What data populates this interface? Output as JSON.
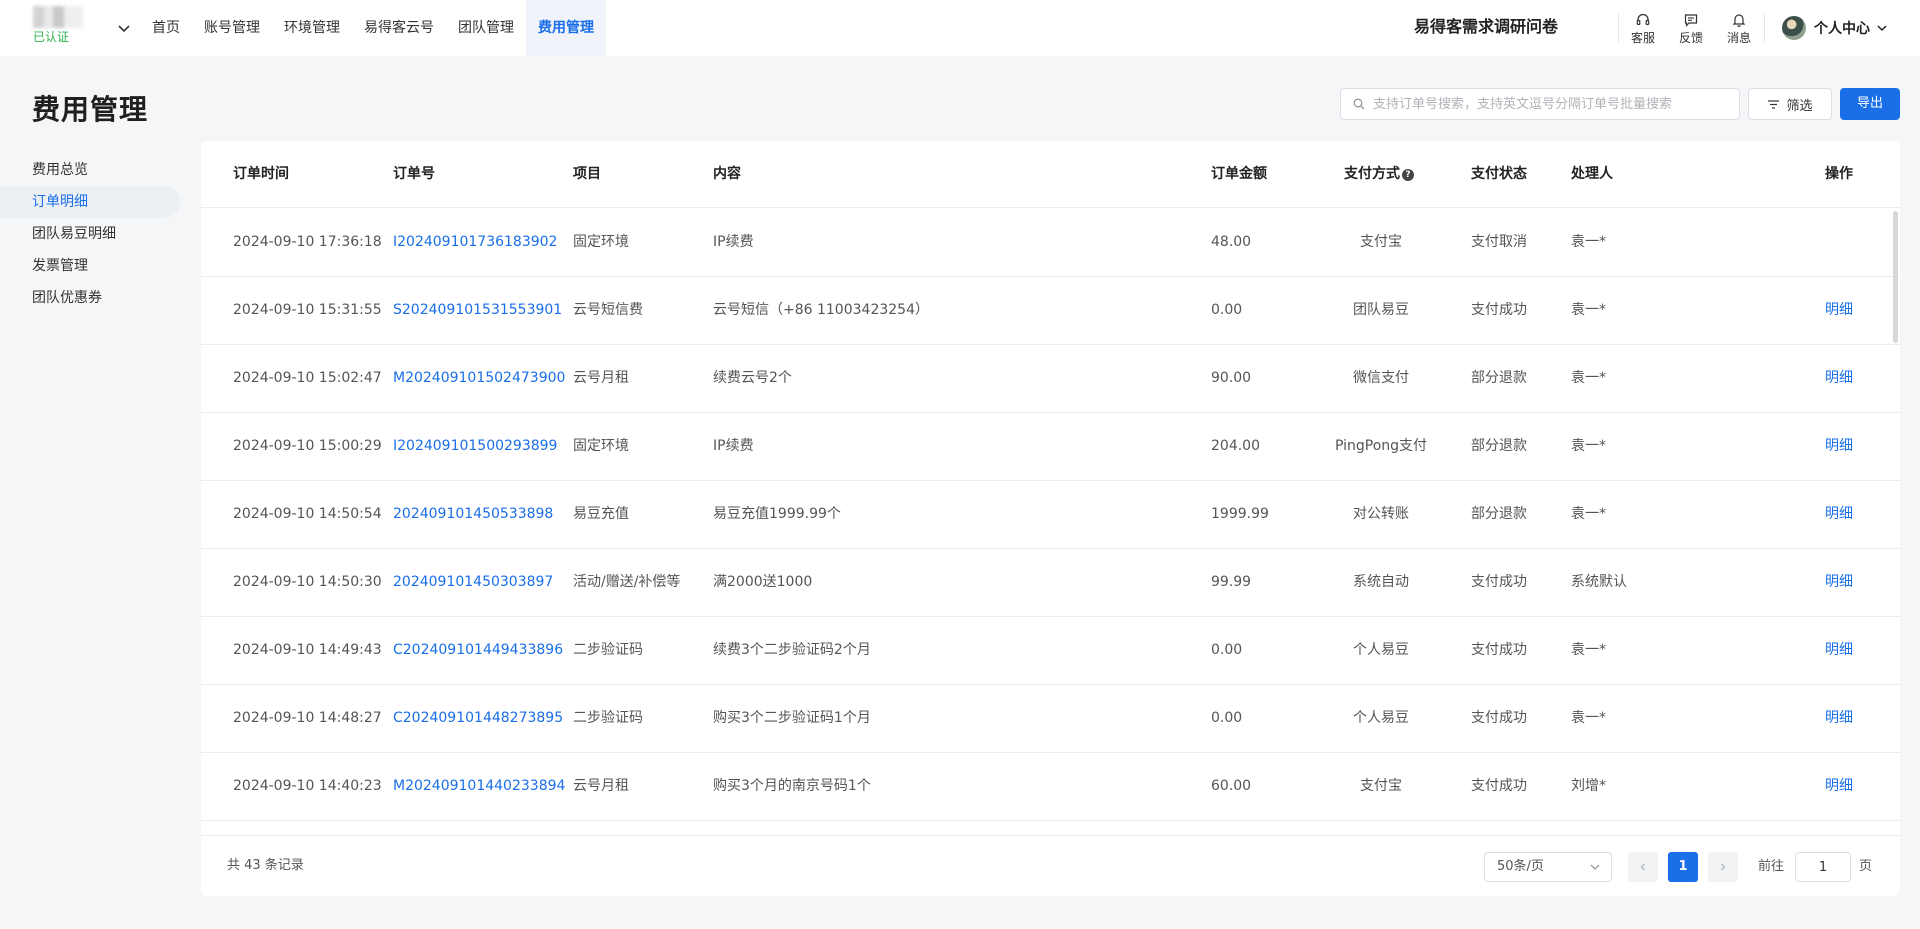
{
  "brand": {
    "verified": "已认证"
  },
  "nav": [
    {
      "label": "首页"
    },
    {
      "label": "账号管理"
    },
    {
      "label": "环境管理"
    },
    {
      "label": "易得客云号"
    },
    {
      "label": "团队管理"
    },
    {
      "label": "费用管理",
      "active": true
    }
  ],
  "header": {
    "survey": "易得客需求调研问卷",
    "tools": {
      "service": "客服",
      "feedback": "反馈",
      "messages": "消息"
    },
    "user": "个人中心"
  },
  "page": {
    "title": "费用管理",
    "search_placeholder": "支持订单号搜索，支持英文逗号分隔订单号批量搜索",
    "filter": "筛选",
    "export": "导出"
  },
  "sidebar": [
    {
      "label": "费用总览"
    },
    {
      "label": "订单明细",
      "active": true
    },
    {
      "label": "团队易豆明细"
    },
    {
      "label": "发票管理"
    },
    {
      "label": "团队优惠券"
    }
  ],
  "table": {
    "columns": {
      "time": "订单时间",
      "order_no": "订单号",
      "project": "项目",
      "content": "内容",
      "amount": "订单金额",
      "pay_method": "支付方式",
      "pay_method_help": "?",
      "pay_status": "支付状态",
      "handler": "处理人",
      "action": "操作"
    },
    "rows": [
      {
        "time": "2024-09-10 17:36:18",
        "order_no": "I202409101736183902",
        "project": "固定环境",
        "content": "IP续费",
        "amount": "48.00",
        "pay_method": "支付宝",
        "pay_status": "支付取消",
        "handler": "袁一*",
        "action": ""
      },
      {
        "time": "2024-09-10 15:31:55",
        "order_no": "S202409101531553901",
        "project": "云号短信费",
        "content": "云号短信（+86 11003423254）",
        "amount": "0.00",
        "pay_method": "团队易豆",
        "pay_status": "支付成功",
        "handler": "袁一*",
        "action": "明细"
      },
      {
        "time": "2024-09-10 15:02:47",
        "order_no": "M202409101502473900",
        "project": "云号月租",
        "content": "续费云号2个",
        "amount": "90.00",
        "pay_method": "微信支付",
        "pay_status": "部分退款",
        "handler": "袁一*",
        "action": "明细"
      },
      {
        "time": "2024-09-10 15:00:29",
        "order_no": "I202409101500293899",
        "project": "固定环境",
        "content": "IP续费",
        "amount": "204.00",
        "pay_method": "PingPong支付",
        "pay_status": "部分退款",
        "handler": "袁一*",
        "action": "明细"
      },
      {
        "time": "2024-09-10 14:50:54",
        "order_no": "202409101450533898",
        "project": "易豆充值",
        "content": "易豆充值1999.99个",
        "amount": "1999.99",
        "pay_method": "对公转账",
        "pay_status": "部分退款",
        "handler": "袁一*",
        "action": "明细"
      },
      {
        "time": "2024-09-10 14:50:30",
        "order_no": "202409101450303897",
        "project": "活动/赠送/补偿等",
        "content": "满2000送1000",
        "amount": "99.99",
        "pay_method": "系统自动",
        "pay_status": "支付成功",
        "handler": "系统默认",
        "action": "明细"
      },
      {
        "time": "2024-09-10 14:49:43",
        "order_no": "C202409101449433896",
        "project": "二步验证码",
        "content": "续费3个二步验证码2个月",
        "amount": "0.00",
        "pay_method": "个人易豆",
        "pay_status": "支付成功",
        "handler": "袁一*",
        "action": "明细"
      },
      {
        "time": "2024-09-10 14:48:27",
        "order_no": "C202409101448273895",
        "project": "二步验证码",
        "content": "购买3个二步验证码1个月",
        "amount": "0.00",
        "pay_method": "个人易豆",
        "pay_status": "支付成功",
        "handler": "袁一*",
        "action": "明细"
      },
      {
        "time": "2024-09-10 14:40:23",
        "order_no": "M202409101440233894",
        "project": "云号月租",
        "content": "购买3个月的南京号码1个",
        "amount": "60.00",
        "pay_method": "支付宝",
        "pay_status": "支付成功",
        "handler": "刘增*",
        "action": "明细"
      }
    ]
  },
  "pagination": {
    "total": "共 43 条记录",
    "page_size": "50条/页",
    "current": "1",
    "goto_label": "前往",
    "goto_value": "1",
    "page_unit": "页"
  }
}
